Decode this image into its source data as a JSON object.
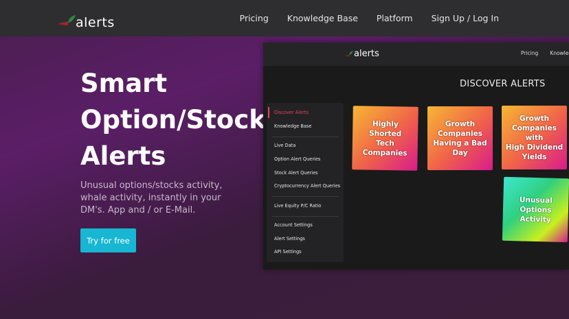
{
  "brand": {
    "name": "alerts"
  },
  "nav": [
    "Pricing",
    "Knowledge Base",
    "Platform",
    "Sign Up / Log In"
  ],
  "hero": {
    "title_lines": [
      "Smart",
      "Option/Stock",
      "Alerts"
    ],
    "subtitle": "Unusual options/stocks activity, whale activity, instantly in your DM's. App and / or E-Mail.",
    "cta": "Try for free"
  },
  "preview": {
    "brand": "alerts",
    "nav": [
      "Pricing",
      "Knowledg"
    ],
    "heading": "DISCOVER ALERTS",
    "sidebar": [
      "Discover Alerts",
      "Knowledge Base",
      "Live Data",
      "Option Alert Queries",
      "Stock Alert Queries",
      "Cryptocurrency Alert Queries",
      "Live Equity P/C Ratio",
      "Account Settings",
      "Alert Settings",
      "API Settings"
    ],
    "cards": [
      {
        "lines": [
          "Highly Shorted",
          "Tech Companies"
        ]
      },
      {
        "lines": [
          "Growth",
          "Companies",
          "Having a Bad",
          "Day"
        ]
      },
      {
        "lines": [
          "Growth",
          "Companies with",
          "High Dividend",
          "Yields"
        ]
      },
      {
        "lines": [
          "Unusual",
          "Options Activity"
        ]
      }
    ]
  },
  "colors": {
    "accent": "#17b6d2",
    "active": "#e8445a",
    "logo_leaf": "#2a8a3e",
    "logo_red": "#b0202a"
  }
}
